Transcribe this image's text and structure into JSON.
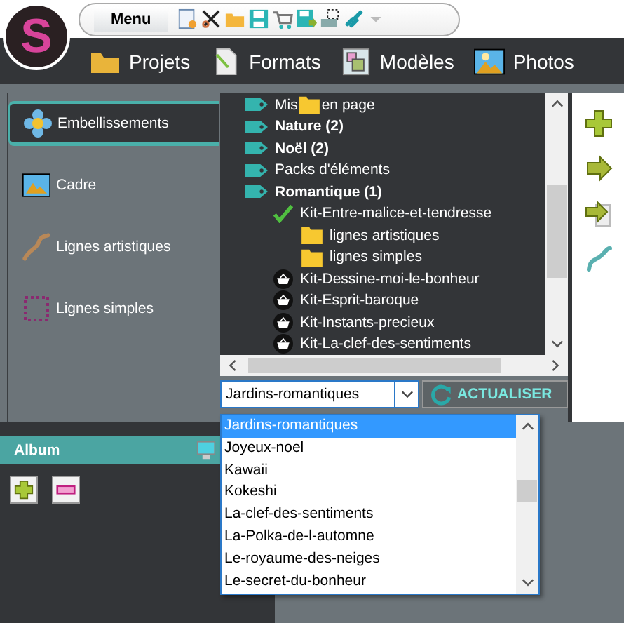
{
  "logo": {
    "letter": "S"
  },
  "toolbar": {
    "menu_button": "Menu"
  },
  "nav": [
    {
      "label": "Projets",
      "kind": "folder"
    },
    {
      "label": "Formats",
      "kind": "page"
    },
    {
      "label": "Modèles",
      "kind": "template"
    },
    {
      "label": "Photos",
      "kind": "photo"
    }
  ],
  "side_tabs": [
    {
      "label": "Embellissements",
      "kind": "flower",
      "selected": true
    },
    {
      "label": "Cadre",
      "kind": "frame",
      "selected": false
    },
    {
      "label": "Lignes artistiques",
      "kind": "stroke",
      "selected": false
    },
    {
      "label": "Lignes simples",
      "kind": "dotted",
      "selected": false
    }
  ],
  "tree": {
    "items": [
      {
        "kind": "category",
        "label_start": "Mis",
        "label_end": "en page",
        "bold": false
      },
      {
        "kind": "category",
        "label": "Nature (2)",
        "bold": true
      },
      {
        "kind": "category",
        "label": "Noël (2)",
        "bold": true
      },
      {
        "kind": "category",
        "label": "Packs d'éléments",
        "bold": false
      },
      {
        "kind": "category",
        "label": "Romantique (1)",
        "bold": true,
        "children": [
          {
            "kind": "kit",
            "label": "Kit-Entre-malice-et-tendresse",
            "installed": true,
            "children": [
              {
                "kind": "folder",
                "label": "lignes artistiques"
              },
              {
                "kind": "folder",
                "label": "lignes simples"
              }
            ]
          },
          {
            "kind": "kit",
            "label": "Kit-Dessine-moi-le-bonheur",
            "installed": false
          },
          {
            "kind": "kit",
            "label": "Kit-Esprit-baroque",
            "installed": false
          },
          {
            "kind": "kit",
            "label": "Kit-Instants-precieux",
            "installed": false
          },
          {
            "kind": "kit",
            "label": "Kit-La-clef-des-sentiments",
            "installed": false
          }
        ]
      }
    ]
  },
  "combo": {
    "value": "Jardins-romantiques",
    "refresh_button": "ACTUALISER",
    "refresh_disabled": true,
    "options": [
      {
        "label": "Jardins-romantiques",
        "selected": true
      },
      {
        "label": "Joyeux-noel",
        "selected": false
      },
      {
        "label": "Kawaii",
        "selected": false
      },
      {
        "label": "Kokeshi",
        "selected": false
      },
      {
        "label": "La-clef-des-sentiments",
        "selected": false
      },
      {
        "label": "La-Polka-de-l-automne",
        "selected": false
      },
      {
        "label": "Le-royaume-des-neiges",
        "selected": false
      },
      {
        "label": "Le-secret-du-bonheur",
        "selected": false
      }
    ]
  },
  "album": {
    "title": "Album"
  }
}
